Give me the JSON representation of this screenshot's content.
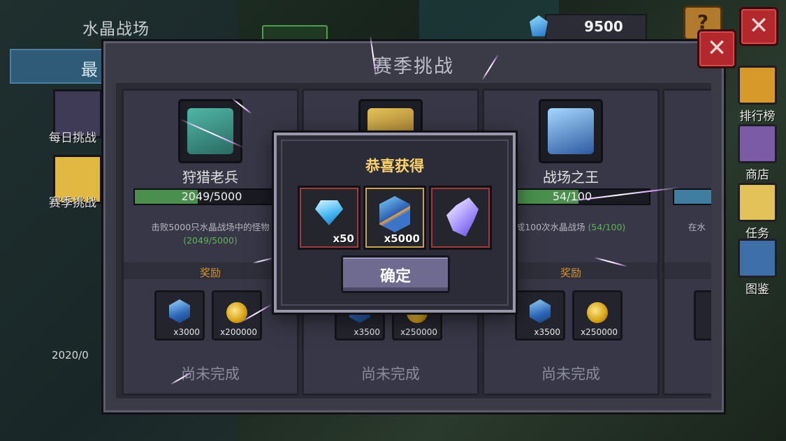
{
  "underlying": {
    "title": "水晶战场",
    "tab_label": "最",
    "daily_label": "每日挑战",
    "season_label": "赛季挑战",
    "date_fragment": "2020/0"
  },
  "resource": {
    "icon": "crystal-icon",
    "value": "9500"
  },
  "help_label": "?",
  "close_symbol": "✕",
  "sidebar": [
    {
      "label": "排行榜",
      "icon": "trophy-icon",
      "color": "#d8992b"
    },
    {
      "label": "商店",
      "icon": "shop-icon",
      "color": "#7b5ba6"
    },
    {
      "label": "任务",
      "icon": "quest-scroll-icon",
      "color": "#e4c25a"
    },
    {
      "label": "图鉴",
      "icon": "collection-book-icon",
      "color": "#3f6fa8"
    }
  ],
  "panel": {
    "title": "赛季挑战",
    "cards": [
      {
        "name": "狩猎老兵",
        "progress_text": "2049/5000",
        "progress": 0.41,
        "desc": "击败5000只水晶战场中的怪物",
        "desc_progress": "(2049/5000)",
        "reward_label": "奖励",
        "rewards": [
          {
            "icon": "crystal-icon",
            "amount": "x3000"
          },
          {
            "icon": "coin-icon",
            "amount": "x200000"
          }
        ],
        "status": "尚未完成"
      },
      {
        "name": "",
        "progress_text": "",
        "progress": 0,
        "desc": "",
        "desc_progress": "",
        "reward_label": "奖励",
        "rewards": [
          {
            "icon": "crystal-icon",
            "amount": "x3500"
          },
          {
            "icon": "coin-icon",
            "amount": "x250000"
          }
        ],
        "status": "尚未完成"
      },
      {
        "name": "战场之王",
        "progress_text": "54/100",
        "progress": 0.54,
        "desc": "成100次水晶战场",
        "desc_progress": "(54/100)",
        "reward_label": "奖励",
        "rewards": [
          {
            "icon": "crystal-icon",
            "amount": "x3500"
          },
          {
            "icon": "coin-icon",
            "amount": "x250000"
          }
        ],
        "status": "尚未完成"
      },
      {
        "name": "",
        "progress_text": "",
        "progress": 0,
        "desc": "在水",
        "desc_progress": "",
        "reward_label": "",
        "rewards": [],
        "status": ""
      }
    ]
  },
  "modal": {
    "title": "恭喜获得",
    "items": [
      {
        "icon": "diamond-icon",
        "amount": "x50"
      },
      {
        "icon": "crystal-icon",
        "amount": "x5000"
      },
      {
        "icon": "wing-icon",
        "amount": ""
      }
    ],
    "confirm_label": "确定"
  }
}
